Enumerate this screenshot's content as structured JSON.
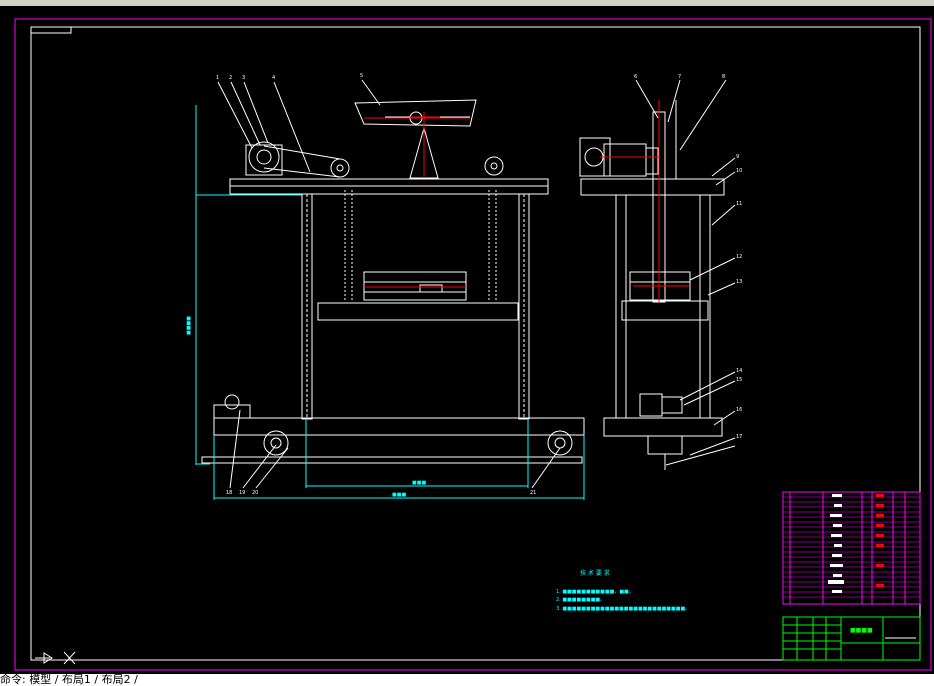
{
  "window": {
    "title": ""
  },
  "drawing": {
    "tech_req_title": "技 术 要 求",
    "tech_req_items": [
      "1. ■■■■■■■■■■■，■■。",
      "2. ■■■■■■■■。",
      "3. ■■■■■■■■■■■■■■■■■■■■■■■■■■。"
    ],
    "title_block_name": "■■■■",
    "dimensions": {
      "total_width": "■■■",
      "inner_width": "■■■",
      "height": "■■■■"
    }
  },
  "command_line": {
    "text": "命令: 模型 / 布局1 / 布局2 /"
  },
  "colors": {
    "frame": "#ff00ff",
    "lines": "#ffffff",
    "dims": "#00ffff",
    "table": "#00ff00",
    "parts": "#ff0000"
  },
  "icons": [
    "ucs-icon"
  ]
}
